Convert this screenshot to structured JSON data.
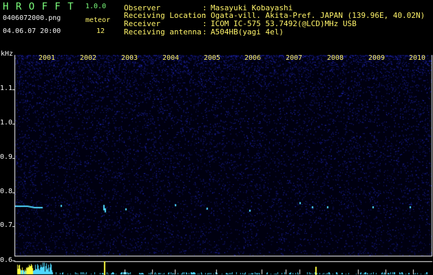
{
  "app": {
    "name": "H R O F F T",
    "version": "1.0.0"
  },
  "file": {
    "name": "0406072000.png",
    "datetime": "04.06.07 20:00"
  },
  "counter": {
    "label": "meteor",
    "value": "12"
  },
  "info": [
    {
      "label": "Observer",
      "sep": ":",
      "value": "Masayuki Kobayashi"
    },
    {
      "label": "Receiving Location",
      "sep": ":",
      "value": "Ogata-vill. Akita-Pref. JAPAN (139.96E, 40.02N)"
    },
    {
      "label": "Receiver",
      "sep": ":",
      "value": "ICOM IC-575 53.7492(@LCD)MHz USB"
    },
    {
      "label": "Receiving antenna",
      "sep": ":",
      "value": "A504HB(yagi 4el)"
    }
  ],
  "axis": {
    "unit": "kHz",
    "y_ticks": [
      "1.1",
      "1.0",
      "0.9",
      "0.8",
      "0.7",
      "0.6"
    ],
    "y_values": [
      1.1,
      1.0,
      0.9,
      0.8,
      0.7,
      0.6
    ],
    "x_labels": [
      "2001",
      "2002",
      "2003",
      "2004",
      "2005",
      "2006",
      "2007",
      "2008",
      "2009",
      "2010"
    ]
  },
  "colors": {
    "green_text": "#7cff7c",
    "white_text": "#f4f4f4",
    "yellow_text": "#fff46a",
    "noise": "#2a32d8",
    "trace_cyan": "#4fd8ff",
    "trace_yellow": "#ffff40"
  }
}
